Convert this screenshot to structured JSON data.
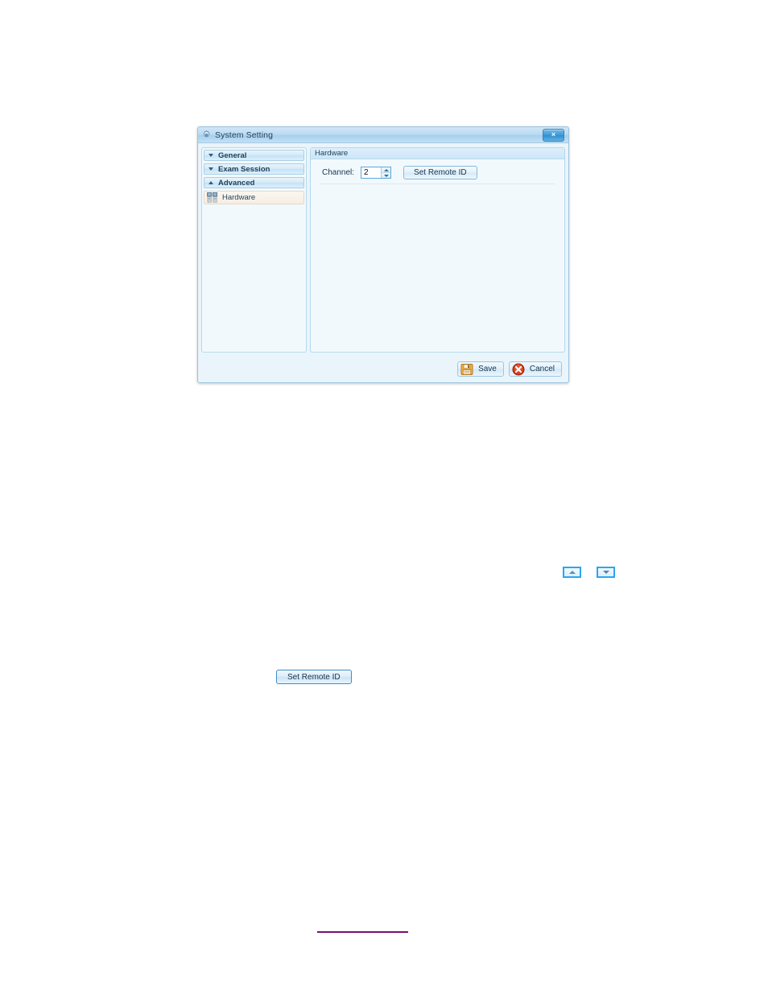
{
  "dialog": {
    "title": "System Setting",
    "title_icon": "gear-icon",
    "close_label": "×",
    "sidebar": {
      "sections": [
        {
          "label": "General",
          "state": "collapsed",
          "arrow": "chevron-down-icon"
        },
        {
          "label": "Exam Session",
          "state": "collapsed",
          "arrow": "chevron-down-icon"
        },
        {
          "label": "Advanced",
          "state": "expanded",
          "arrow": "chevron-up-icon"
        }
      ],
      "items": [
        {
          "label": "Hardware",
          "icon": "hardware-devices-icon",
          "selected": true
        }
      ]
    },
    "content": {
      "group_title": "Hardware",
      "channel_label": "Channel:",
      "channel_value": "2",
      "set_remote_id_label": "Set Remote ID"
    },
    "footer": {
      "save_label": "Save",
      "save_icon": "floppy-disk-icon",
      "cancel_label": "Cancel",
      "cancel_icon": "red-x-circle-icon"
    }
  },
  "callouts": {
    "spinner_up_icon": "spinner-up-arrow-icon",
    "spinner_down_icon": "spinner-down-arrow-icon",
    "set_remote_id_label": "Set Remote ID"
  },
  "colors": {
    "accent": "#29a7ef",
    "dialog_border": "#9cc3de",
    "panel_bg": "#f2f9fd",
    "title_text": "#23425c",
    "link_rule": "#7b0f72",
    "save_icon": "#e8a33d",
    "cancel_icon": "#cc3322"
  }
}
